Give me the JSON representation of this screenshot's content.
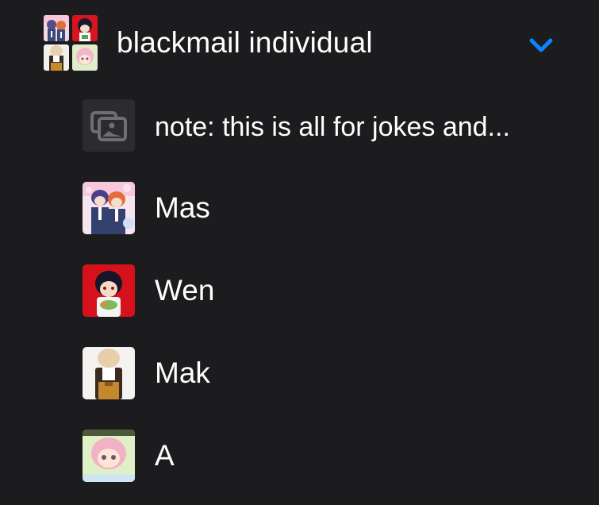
{
  "album": {
    "title": "blackmail individual",
    "expanded": true,
    "chevron_icon": "chevron-down-icon",
    "accent_color": "#0a84ff"
  },
  "items": [
    {
      "label": "note: this is all for jokes and...",
      "icon": "photo-stack-icon"
    },
    {
      "label": "Mas"
    },
    {
      "label": "Wen"
    },
    {
      "label": "Mak"
    },
    {
      "label": "A"
    }
  ],
  "colors": {
    "background": "#1c1c1e",
    "text": "#ffffff",
    "placeholder_tile": "#2c2c2e",
    "placeholder_icon": "#6e6e73"
  }
}
